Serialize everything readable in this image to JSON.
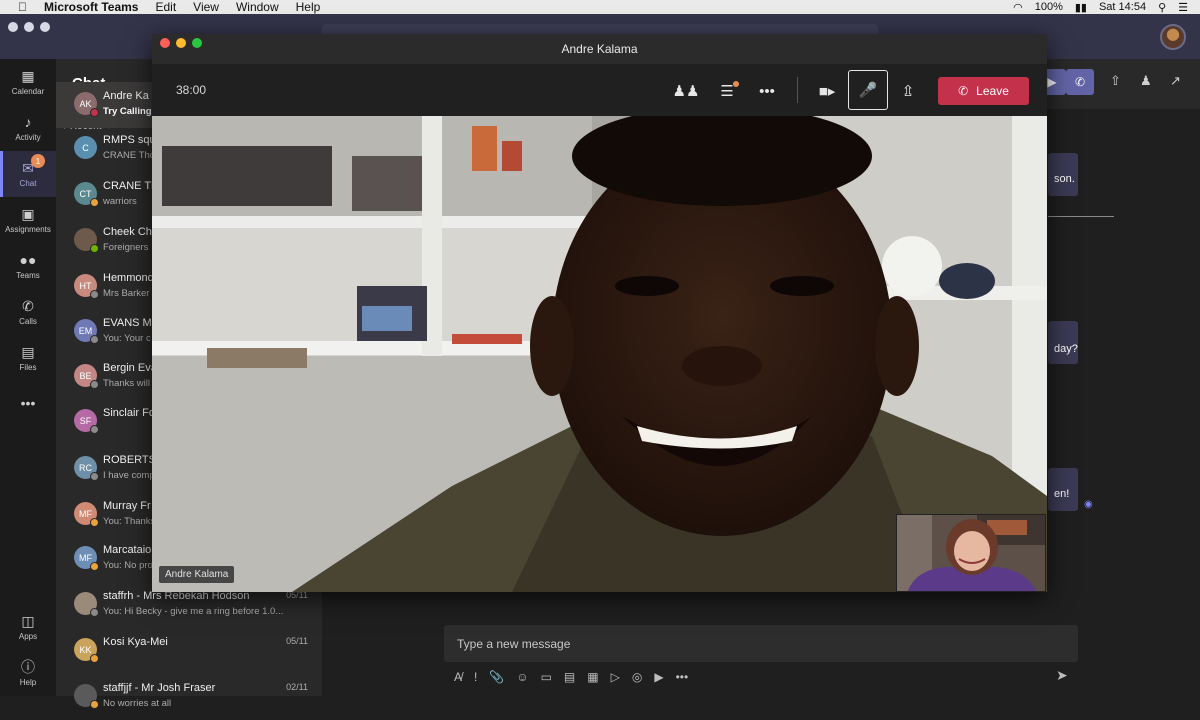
{
  "menubar": {
    "app": "Microsoft Teams",
    "items": [
      "Edit",
      "View",
      "Window",
      "Help"
    ],
    "battery": "100%",
    "clock": "Sat 14:54"
  },
  "rail": [
    {
      "label": "Calendar",
      "icon": "calendar-icon"
    },
    {
      "label": "Activity",
      "icon": "bell-icon"
    },
    {
      "label": "Chat",
      "icon": "chat-icon",
      "active": true,
      "badge": "1"
    },
    {
      "label": "Assignments",
      "icon": "assignments-icon"
    },
    {
      "label": "Teams",
      "icon": "teams-icon"
    },
    {
      "label": "Calls",
      "icon": "phone-icon"
    },
    {
      "label": "Files",
      "icon": "file-icon"
    },
    {
      "label": "Apps",
      "icon": "apps-icon"
    },
    {
      "label": "Help",
      "icon": "help-icon"
    }
  ],
  "chatlist": {
    "title": "Chat",
    "section": "Recent",
    "items": [
      {
        "initials": "AK",
        "name": "Andre Ka",
        "preview": "Try Calling",
        "date": "",
        "color": "#8b6b6b",
        "status": "#c4314b"
      },
      {
        "initials": "C",
        "name": "RMPS squ",
        "preview": "CRANE Tho",
        "date": "",
        "color": "#5b8fb0",
        "status": ""
      },
      {
        "initials": "CT",
        "name": "CRANE Th",
        "preview": "warriors",
        "date": "",
        "color": "#5a8a8f",
        "status": "#e8a33d"
      },
      {
        "initials": "",
        "name": "Cheek Ch",
        "preview": "Foreigners",
        "date": "",
        "color": "#6d5a4a",
        "status": "#6bb700"
      },
      {
        "initials": "HT",
        "name": "Hemmond",
        "preview": "Mrs Barker",
        "date": "",
        "color": "#c98a7e",
        "status": "#8a8a8a"
      },
      {
        "initials": "EM",
        "name": "EVANS M",
        "preview": "You: Your c",
        "date": "",
        "color": "#6e79b5",
        "status": "#8a8a8a"
      },
      {
        "initials": "BE",
        "name": "Bergin Eva",
        "preview": "Thanks will",
        "date": "",
        "color": "#c48585",
        "status": "#8a8a8a"
      },
      {
        "initials": "SF",
        "name": "Sinclair Fo",
        "preview": "",
        "date": "",
        "color": "#b66aa5",
        "status": "#8a8a8a"
      },
      {
        "initials": "RC",
        "name": "ROBERTSO",
        "preview": "I have comp",
        "date": "",
        "color": "#6d8fa8",
        "status": "#8a8a8a"
      },
      {
        "initials": "MF",
        "name": "Murray Fr",
        "preview": "You: Thanks",
        "date": "",
        "color": "#d08a74",
        "status": "#e8a33d"
      },
      {
        "initials": "MF",
        "name": "Marcataio",
        "preview": "You: No pro",
        "date": "",
        "color": "#6e8fb5",
        "status": "#e8a33d"
      },
      {
        "initials": "",
        "name": "staffrh - Mrs Rebekah Hodson",
        "preview": "You: Hi Becky - give me a ring before 1.0...",
        "date": "05/11",
        "color": "#9a8a7a",
        "status": "#8a8a8a"
      },
      {
        "initials": "KK",
        "name": "Kosi Kya-Mei",
        "preview": "",
        "date": "05/11",
        "color": "#c9a45a",
        "status": "#e8a33d"
      },
      {
        "initials": "",
        "name": "staffjjf - Mr Josh Fraser",
        "preview": "No worries at all",
        "date": "02/11",
        "color": "#5a5a5a",
        "status": "#e8a33d"
      }
    ]
  },
  "main": {
    "bubbles": [
      "son.",
      "day?",
      "en!"
    ],
    "message_placeholder": "Type a new message"
  },
  "call": {
    "window_title": "Andre Kalama",
    "timer": "38:00",
    "leave_label": "Leave",
    "participant_name": "Andre Kalama"
  }
}
